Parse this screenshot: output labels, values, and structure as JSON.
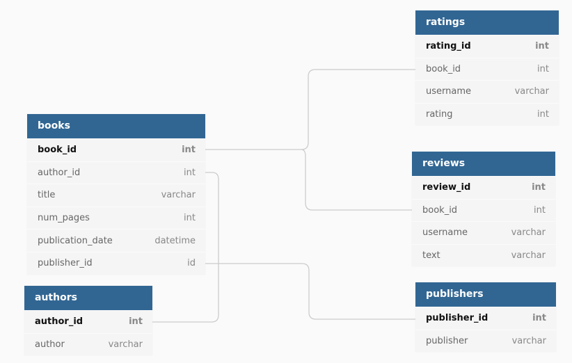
{
  "colors": {
    "header": "#316693",
    "background": "#fafafa",
    "line": "#cccccc"
  },
  "tables": {
    "books": {
      "name": "books",
      "fields": [
        {
          "name": "book_id",
          "type": "int",
          "pk": true
        },
        {
          "name": "author_id",
          "type": "int"
        },
        {
          "name": "title",
          "type": "varchar"
        },
        {
          "name": "num_pages",
          "type": "int"
        },
        {
          "name": "publication_date",
          "type": "datetime"
        },
        {
          "name": "publisher_id",
          "type": "id"
        }
      ]
    },
    "authors": {
      "name": "authors",
      "fields": [
        {
          "name": "author_id",
          "type": "int",
          "pk": true
        },
        {
          "name": "author",
          "type": "varchar"
        }
      ]
    },
    "ratings": {
      "name": "ratings",
      "fields": [
        {
          "name": "rating_id",
          "type": "int",
          "pk": true
        },
        {
          "name": "book_id",
          "type": "int"
        },
        {
          "name": "username",
          "type": "varchar"
        },
        {
          "name": "rating",
          "type": "int"
        }
      ]
    },
    "reviews": {
      "name": "reviews",
      "fields": [
        {
          "name": "review_id",
          "type": "int",
          "pk": true
        },
        {
          "name": "book_id",
          "type": "int"
        },
        {
          "name": "username",
          "type": "varchar"
        },
        {
          "name": "text",
          "type": "varchar"
        }
      ]
    },
    "publishers": {
      "name": "publishers",
      "fields": [
        {
          "name": "publisher_id",
          "type": "int",
          "pk": true
        },
        {
          "name": "publisher",
          "type": "varchar"
        }
      ]
    }
  },
  "relations": [
    {
      "from": "books.book_id",
      "to": "ratings.book_id"
    },
    {
      "from": "books.book_id",
      "to": "reviews.book_id"
    },
    {
      "from": "books.author_id",
      "to": "authors.author_id"
    },
    {
      "from": "books.publisher_id",
      "to": "publishers.publisher_id"
    }
  ]
}
